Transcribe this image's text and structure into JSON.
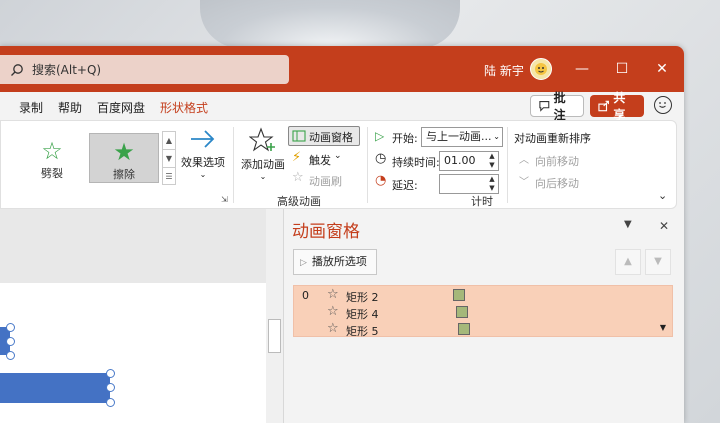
{
  "titlebar": {
    "search_placeholder": "搜索(Alt+Q)",
    "user_name": "陆 新宇",
    "minimize": "—",
    "maximize": "☐",
    "close": "✕"
  },
  "menu": {
    "items": [
      "录制",
      "帮助",
      "百度网盘",
      "形状格式"
    ],
    "comment": "批注",
    "share": "共享"
  },
  "ribbon": {
    "gallery": [
      {
        "label": "劈裂",
        "selected": false
      },
      {
        "label": "擦除",
        "selected": true
      }
    ],
    "effect_options": "效果选项",
    "add_animation": "添加动画",
    "animation_pane": "动画窗格",
    "trigger": "触发",
    "animation_painter": "动画刷",
    "advanced_group": "高级动画",
    "start_label": "开始:",
    "start_value": "与上一动画...",
    "duration_label": "持续时间:",
    "duration_value": "01.00",
    "delay_label": "延迟:",
    "delay_value": "",
    "timing_group": "计时",
    "reorder_title": "对动画重新排序",
    "move_earlier": "向前移动",
    "move_later": "向后移动"
  },
  "pane": {
    "title": "动画窗格",
    "play": "播放所选项",
    "items": [
      {
        "num": "0",
        "name": "矩形 2"
      },
      {
        "num": "",
        "name": "矩形 4"
      },
      {
        "num": "",
        "name": "矩形 5"
      }
    ]
  },
  "colors": {
    "accent": "#c43e1c",
    "list_highlight": "#f9d0b8",
    "shape_fill": "#4472c4"
  }
}
